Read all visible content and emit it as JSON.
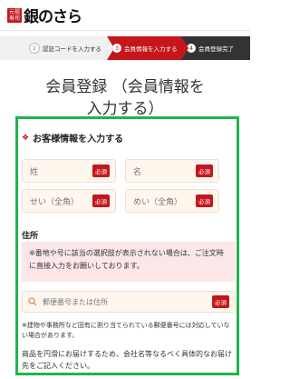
{
  "header": {
    "logo_badge": "元祖寿司",
    "logo_text": "銀のさら"
  },
  "steps": [
    {
      "num": "2",
      "label": "認証コードを入力する"
    },
    {
      "num": "3",
      "label": "会員情報を入力する"
    },
    {
      "num": "4",
      "label": "会員登録完了"
    }
  ],
  "page": {
    "title_line1": "会員登録 （会員情報を",
    "title_line2": "入力する）"
  },
  "form": {
    "section_title": "お客様情報を入力する",
    "required_label": "必須",
    "fields": {
      "last_name": "姓",
      "first_name": "名",
      "last_kana": "せい（全角）",
      "first_kana": "めい（全角）"
    },
    "address_label": "住所",
    "notice": "※番地や号に該当の選択肢が表示されない場合は、ご注文時に直接入力をお願いしております。",
    "postal_placeholder": "郵便番号または住所",
    "note_small": "※建物や事務所など固有に割り当てられている郵便番号には対応していない場合があります。",
    "note_bottom": "商品を円滑にお届けするため、会社名等なるべく具体的なお届け先をご記入ください。"
  },
  "colors": {
    "brand": "#c4161c",
    "highlight": "#1fb54a",
    "field_bg": "#fff6ee"
  }
}
